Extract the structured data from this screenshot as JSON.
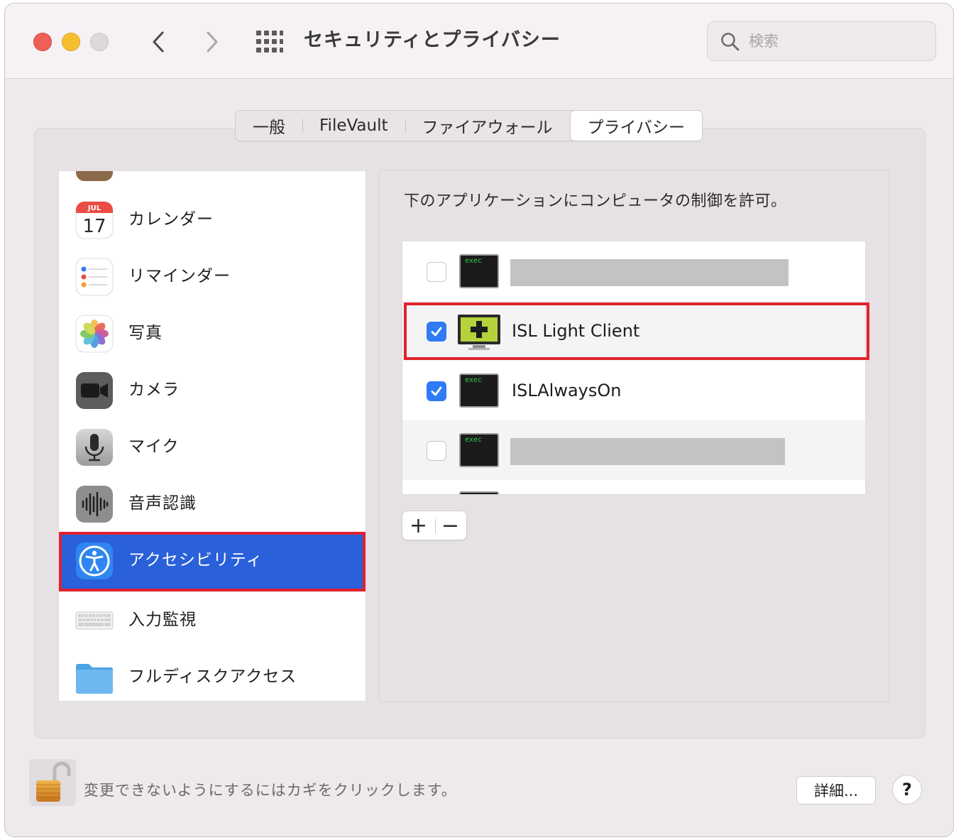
{
  "window": {
    "title": "セキュリティとプライバシー",
    "search_placeholder": "検索"
  },
  "tabs": [
    {
      "label": "一般",
      "active": false
    },
    {
      "label": "FileVault",
      "active": false
    },
    {
      "label": "ファイアウォール",
      "active": false
    },
    {
      "label": "プライバシー",
      "active": true
    }
  ],
  "sidebar": {
    "items": [
      {
        "label": "カレンダー",
        "icon": "calendar-icon",
        "calendar_month": "JUL",
        "calendar_day": "17"
      },
      {
        "label": "リマインダー",
        "icon": "reminders-icon"
      },
      {
        "label": "写真",
        "icon": "photos-icon"
      },
      {
        "label": "カメラ",
        "icon": "camera-icon"
      },
      {
        "label": "マイク",
        "icon": "microphone-icon"
      },
      {
        "label": "音声認識",
        "icon": "speech-recognition-icon"
      },
      {
        "label": "アクセシビリティ",
        "icon": "accessibility-icon",
        "selected": true
      },
      {
        "label": "入力監視",
        "icon": "keyboard-icon"
      },
      {
        "label": "フルディスクアクセス",
        "icon": "folder-icon"
      }
    ]
  },
  "permission": {
    "description": "下のアプリケーションにコンピュータの制御を許可。",
    "apps": [
      {
        "name": "",
        "checked": false,
        "icon": "exec-icon",
        "icon_text": "exec",
        "redacted": true
      },
      {
        "name": "ISL Light Client",
        "checked": true,
        "icon": "isl-light-icon",
        "highlighted": true
      },
      {
        "name": "ISLAlwaysOn",
        "checked": true,
        "icon": "exec-icon",
        "icon_text": "exec"
      },
      {
        "name": "",
        "checked": false,
        "icon": "exec-icon",
        "icon_text": "exec",
        "redacted": true
      }
    ],
    "add_label": "+",
    "remove_label": "−"
  },
  "footer": {
    "lock_text": "変更できないようにするにはカギをクリックします。",
    "details_label": "詳細...",
    "help_label": "?"
  },
  "colors": {
    "selection": "#2a60d9",
    "highlight": "#e0222d",
    "checkbox_on": "#2f7bf5"
  }
}
